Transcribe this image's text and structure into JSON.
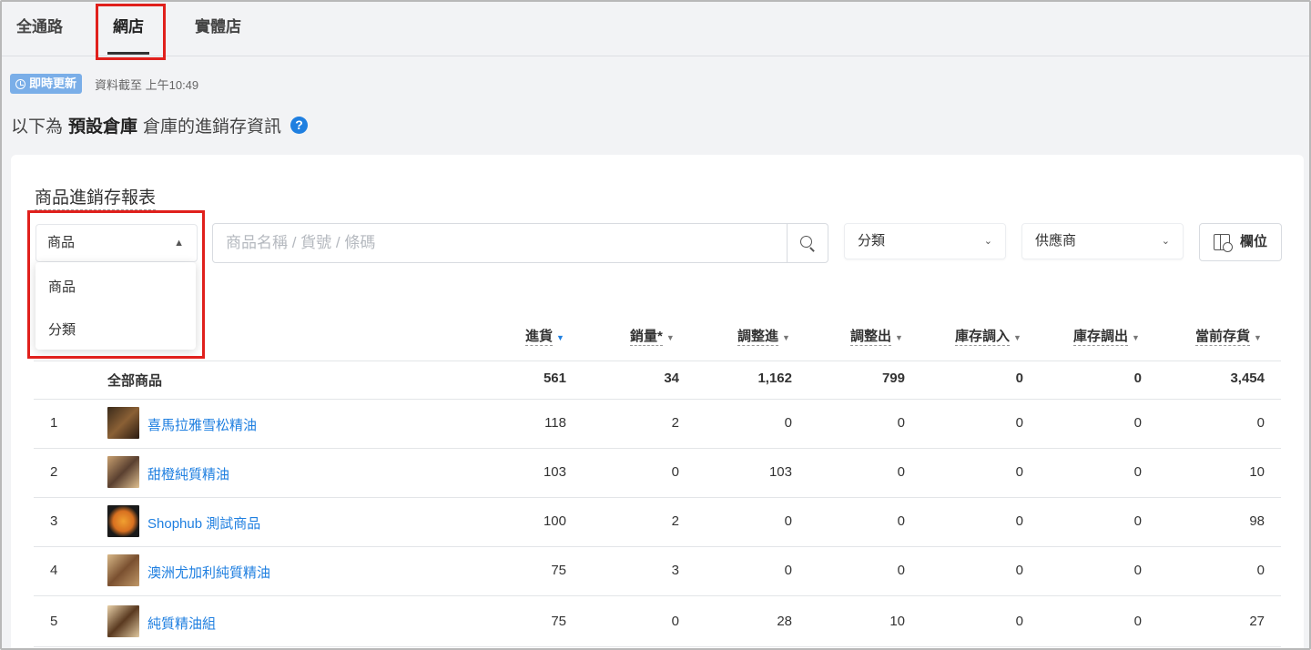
{
  "tabs": [
    {
      "label": "全通路"
    },
    {
      "label": "網店"
    },
    {
      "label": "實體店"
    }
  ],
  "status": {
    "badge": "即時更新",
    "data_time": "資料截至 上午10:49"
  },
  "info": {
    "prefix": "以下為",
    "warehouse": "預設倉庫",
    "suffix": "倉庫的進銷存資訊",
    "help": "?"
  },
  "report": {
    "title": "商品進銷存報表",
    "dimension_selected": "商品",
    "dimension_options": [
      "商品",
      "分類"
    ],
    "search_placeholder": "商品名稱 / 貨號 / 條碼",
    "category_filter": "分類",
    "supplier_filter": "供應商",
    "columns_button": "欄位"
  },
  "table": {
    "headers": [
      "進貨",
      "銷量*",
      "調整進",
      "調整出",
      "庫存調入",
      "庫存調出",
      "當前存貨"
    ],
    "total": {
      "label": "全部商品",
      "values": [
        "561",
        "34",
        "1,162",
        "799",
        "0",
        "0",
        "3,454"
      ]
    },
    "rows": [
      {
        "rank": "1",
        "name": "喜馬拉雅雪松精油",
        "thumb_color": "#6b4a2a",
        "values": [
          "118",
          "2",
          "0",
          "0",
          "0",
          "0",
          "0"
        ]
      },
      {
        "rank": "2",
        "name": "甜橙純質精油",
        "thumb_color": "#8a6a45",
        "values": [
          "103",
          "0",
          "103",
          "0",
          "0",
          "0",
          "10"
        ]
      },
      {
        "rank": "3",
        "name": "Shophub 測試商品",
        "thumb_color": "#d98a2a",
        "values": [
          "100",
          "2",
          "0",
          "0",
          "0",
          "0",
          "98"
        ]
      },
      {
        "rank": "4",
        "name": "澳洲尤加利純質精油",
        "thumb_color": "#9a7048",
        "values": [
          "75",
          "3",
          "0",
          "0",
          "0",
          "0",
          "0"
        ]
      },
      {
        "rank": "5",
        "name": "純質精油組",
        "thumb_color": "#b89060",
        "values": [
          "75",
          "0",
          "28",
          "10",
          "0",
          "0",
          "27"
        ]
      }
    ]
  },
  "colors": {
    "accent": "#1f7fe0",
    "highlight": "#e0201c",
    "badge": "#7aaee8"
  }
}
